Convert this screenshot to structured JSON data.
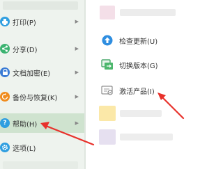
{
  "left_menu": {
    "items": [
      {
        "label": "打印(P)",
        "icon": "printer-icon",
        "color": "#2f9ee0",
        "has_submenu": true,
        "active": false
      },
      {
        "label": "分享(D)",
        "icon": "share-icon",
        "color": "#3cb371",
        "has_submenu": true,
        "active": false
      },
      {
        "label": "文档加密(E)",
        "icon": "lock-icon",
        "color": "#3a7bd5",
        "has_submenu": true,
        "active": false
      },
      {
        "label": "备份与恢复(K)",
        "icon": "backup-icon",
        "color": "#f08c1e",
        "has_submenu": true,
        "active": false
      },
      {
        "label": "帮助(H)",
        "icon": "help-icon",
        "color": "#2f9ee0",
        "has_submenu": true,
        "active": true
      },
      {
        "label": "选项(L)",
        "icon": "gear-icon",
        "color": "#2f9ee0",
        "has_submenu": false,
        "active": false
      }
    ]
  },
  "submenu": {
    "items": [
      {
        "label": "检查更新(U)",
        "icon": "update-icon"
      },
      {
        "label": "切换版本(G)",
        "icon": "switch-version-icon"
      },
      {
        "label": "激活产品(I)",
        "icon": "activate-product-icon"
      }
    ]
  },
  "colors": {
    "annotation_arrow": "#e8312b",
    "active_item_background": "#cfe3cf",
    "menu_background": "#eef3ee"
  }
}
